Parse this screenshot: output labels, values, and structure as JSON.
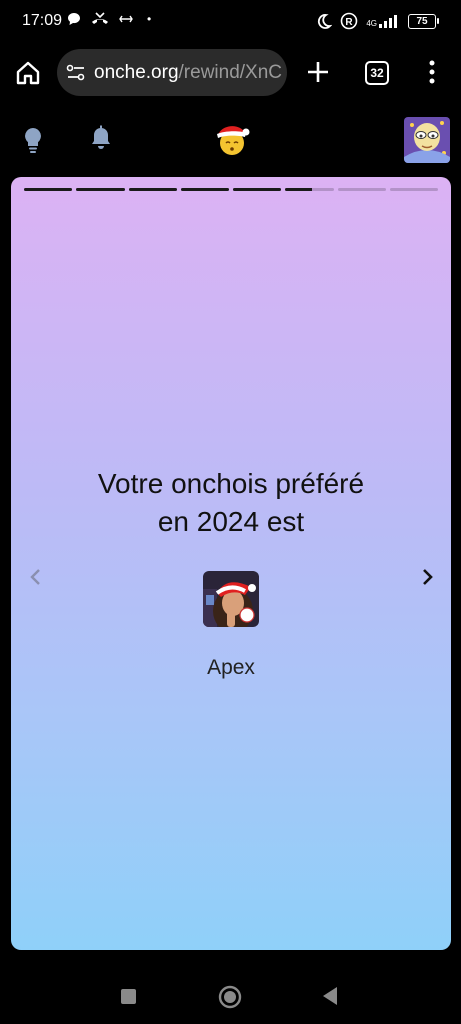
{
  "status_bar": {
    "time": "17:09",
    "dot": "•",
    "network_label": "4G",
    "battery": "75",
    "icons": [
      "chat-bubble-icon",
      "missed-call-icon",
      "data-transfer-icon",
      "moon-icon",
      "registered-icon",
      "signal-icon",
      "battery-icon"
    ]
  },
  "browser": {
    "url_domain": "onche.org",
    "url_path": "/rewind/XnC",
    "tab_count": "32"
  },
  "site_header": {
    "icons": [
      "lightbulb-icon",
      "bell-icon",
      "santa-smiley-logo",
      "user-avatar"
    ]
  },
  "story": {
    "segments_total": 8,
    "segment_progress": [
      1,
      1,
      1,
      1,
      1,
      0.55,
      0,
      0
    ],
    "title_line1": "Votre onchois préféré",
    "title_line2": "en 2024 est",
    "favorite_name": "Apex",
    "gradient": {
      "top": "#dcb2f4",
      "bottom": "#8fd0f9"
    }
  },
  "nav_bar": {
    "icons": [
      "recent-apps-icon",
      "home-circle-icon",
      "back-triangle-icon"
    ]
  }
}
